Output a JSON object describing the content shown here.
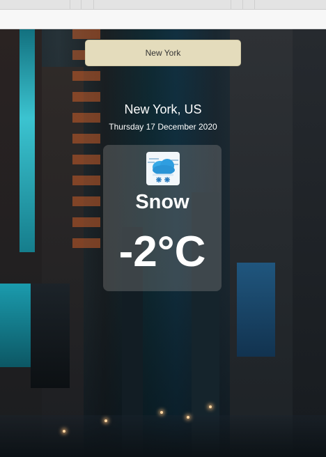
{
  "search": {
    "value": "New York"
  },
  "location": {
    "city": "New York, US"
  },
  "date": "Thursday 17 December 2020",
  "weather": {
    "condition": "Snow",
    "temperature": "-2°C",
    "icon": "snow-cloud-icon"
  },
  "colors": {
    "search_bg": "#e4dcbc",
    "card_bg": "rgba(130,130,130,0.38)",
    "text": "#ffffff"
  }
}
